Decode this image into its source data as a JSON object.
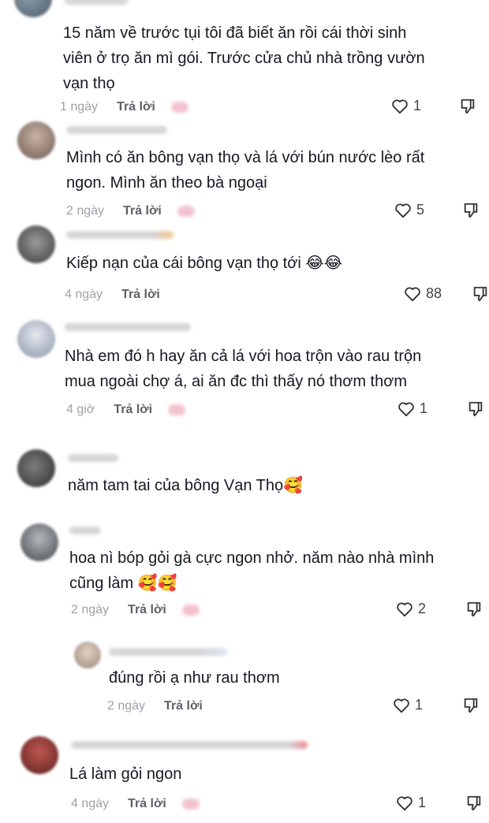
{
  "comments": [
    {
      "text": "15 năm về trước tụi tôi đã biết ăn rồi cái thời sinh\nviên ở trọ ăn mì gói. Trước cửa chủ nhà trồng vườn\nvạn thọ",
      "time": "1 ngày",
      "reply_label": "Trả lời",
      "likes": "1"
    },
    {
      "text": "Mình có ăn bông vạn thọ và lá với bún nước lèo rất\nngon. Mình ăn theo bà ngoại",
      "time": "2 ngày",
      "reply_label": "Trả lời",
      "likes": "5"
    },
    {
      "text": "Kiếp nạn của cái bông vạn thọ tới 😂😂",
      "time": "4 ngày",
      "reply_label": "Trả lời",
      "likes": "88"
    },
    {
      "text": "Nhà em đó h hay ăn cả lá với hoa trộn vào rau trộn\nmua ngoài chợ á, ai ăn đc thì thấy nó thơm thơm",
      "time": "4 giờ",
      "reply_label": "Trả lời",
      "likes": "1"
    },
    {
      "text": "năm tam tai của bông Vạn Thọ🥰",
      "time": "",
      "reply_label": "",
      "likes": ""
    },
    {
      "text": "hoa nì bóp gỏi gà cực ngon nhở. năm nào nhà mình\ncũng làm 🥰🥰",
      "time": "2 ngày",
      "reply_label": "Trả lời",
      "likes": "2"
    },
    {
      "text": "đúng rồi ạ như rau thơm",
      "time": "2 ngày",
      "reply_label": "Trả lời",
      "likes": "1"
    },
    {
      "text": "Lá làm gỏi ngon",
      "time": "4 ngày",
      "reply_label": "Trả lời",
      "likes": "1"
    }
  ],
  "colors": {
    "text": "#161823",
    "meta": "#8a8b91",
    "reply": "#5f6066"
  },
  "icons": {
    "like": "heart-outline-icon",
    "dislike": "thumb-down-icon"
  }
}
